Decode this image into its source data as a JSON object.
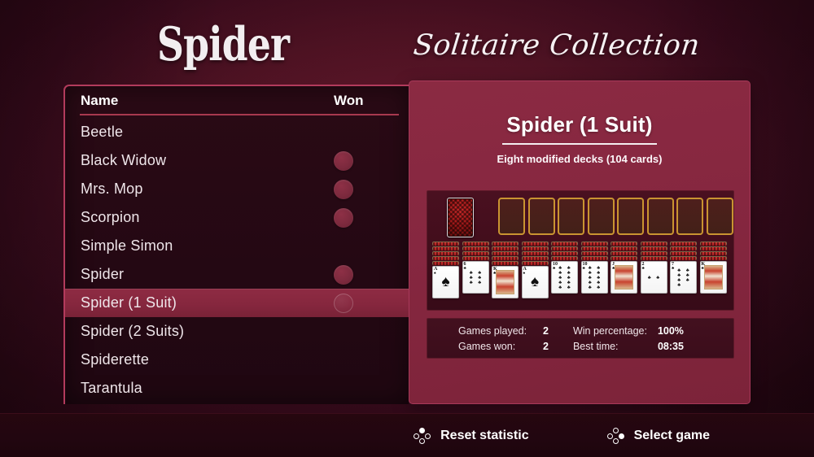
{
  "header": {
    "title": "Spider",
    "subtitle": "Solitaire Collection"
  },
  "game_list": {
    "columns": {
      "name": "Name",
      "won": "Won"
    },
    "items": [
      {
        "name": "Beetle",
        "won": false,
        "selected": false
      },
      {
        "name": "Black Widow",
        "won": true,
        "selected": false
      },
      {
        "name": "Mrs. Mop",
        "won": true,
        "selected": false
      },
      {
        "name": "Scorpion",
        "won": true,
        "selected": false
      },
      {
        "name": "Simple Simon",
        "won": false,
        "selected": false
      },
      {
        "name": "Spider",
        "won": true,
        "selected": false
      },
      {
        "name": "Spider (1 Suit)",
        "won": true,
        "selected": true
      },
      {
        "name": "Spider (2 Suits)",
        "won": false,
        "selected": false
      },
      {
        "name": "Spiderette",
        "won": false,
        "selected": false
      },
      {
        "name": "Tarantula",
        "won": false,
        "selected": false
      }
    ]
  },
  "detail": {
    "title": "Spider (1 Suit)",
    "subtitle": "Eight modified decks (104 cards)",
    "board": {
      "stock_label": "stock-pile",
      "foundation_slots": 8,
      "tableau_columns": [
        {
          "face_down": 5,
          "face_up": {
            "rank": "A",
            "suit": "spades"
          }
        },
        {
          "face_down": 4,
          "face_up": {
            "rank": "6",
            "suit": "clubs"
          }
        },
        {
          "face_down": 5,
          "face_up": {
            "rank": "K",
            "suit": "clubs"
          }
        },
        {
          "face_down": 5,
          "face_up": {
            "rank": "A",
            "suit": "spades"
          }
        },
        {
          "face_down": 4,
          "face_up": {
            "rank": "10",
            "suit": "clubs"
          }
        },
        {
          "face_down": 4,
          "face_up": {
            "rank": "10",
            "suit": "clubs"
          }
        },
        {
          "face_down": 4,
          "face_up": {
            "rank": "J",
            "suit": "clubs"
          }
        },
        {
          "face_down": 4,
          "face_up": {
            "rank": "2",
            "suit": "clubs"
          }
        },
        {
          "face_down": 4,
          "face_up": {
            "rank": "7",
            "suit": "clubs"
          }
        },
        {
          "face_down": 4,
          "face_up": {
            "rank": "K",
            "suit": "clubs"
          }
        }
      ]
    },
    "stats": {
      "games_played_label": "Games played:",
      "games_played_value": "2",
      "games_won_label": "Games won:",
      "games_won_value": "2",
      "win_percentage_label": "Win percentage:",
      "win_percentage_value": "100%",
      "best_time_label": "Best time:",
      "best_time_value": "08:35"
    }
  },
  "bottom_bar": {
    "reset_label": "Reset statistic",
    "reset_icon": "gamepad-button-y-icon",
    "select_label": "Select game",
    "select_icon": "gamepad-button-b-icon"
  },
  "colors": {
    "background": "#4a1020",
    "panel_detail": "#862740",
    "panel_list": "#240813",
    "accent_border": "#b33b5c",
    "selected_row": "#8e2b43",
    "slot_border": "#c99431",
    "text": "#ffffff"
  }
}
